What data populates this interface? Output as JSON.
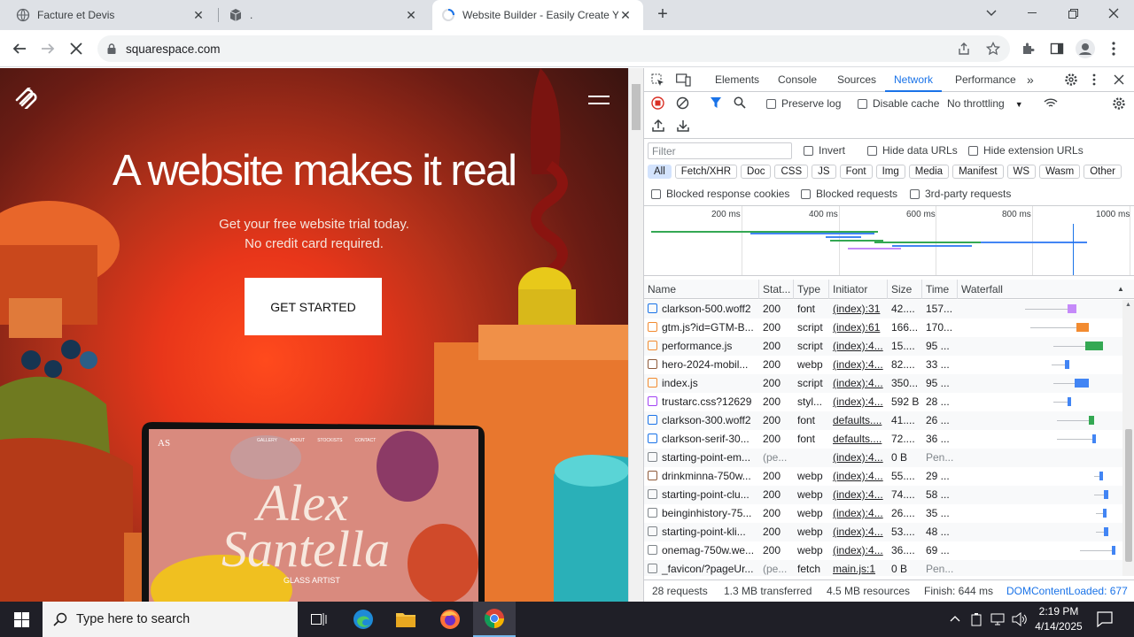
{
  "tabs": [
    {
      "title": "Facture et Devis",
      "favicon": "globe-icon"
    },
    {
      "title": ".",
      "favicon": "cube-icon"
    },
    {
      "title": "Website Builder - Easily Create Y",
      "favicon": "chrome-loading-icon",
      "active": true
    }
  ],
  "toolbar": {
    "url": "squarespace.com"
  },
  "page": {
    "headline": "A website makes it real",
    "subline1": "Get your free website trial today.",
    "subline2": "No credit card required.",
    "cta": "GET STARTED",
    "laptop_name1": "Alex",
    "laptop_name2": "Santella",
    "laptop_caption": "GLASS ARTIST",
    "laptop_nav": [
      "GALLERY",
      "ABOUT",
      "STOCKISTS",
      "CONTACT"
    ],
    "laptop_logo": "AS"
  },
  "devtools": {
    "tabs": [
      "Elements",
      "Console",
      "Sources",
      "Network",
      "Performance"
    ],
    "active_tab": "Network",
    "preserve_log": "Preserve log",
    "disable_cache": "Disable cache",
    "throttling": "No throttling",
    "filter_placeholder": "Filter",
    "invert": "Invert",
    "hide_data_urls": "Hide data URLs",
    "hide_extension_urls": "Hide extension URLs",
    "type_filters": [
      "All",
      "Fetch/XHR",
      "Doc",
      "CSS",
      "JS",
      "Font",
      "Img",
      "Media",
      "Manifest",
      "WS",
      "Wasm",
      "Other"
    ],
    "blocked_response_cookies": "Blocked response cookies",
    "blocked_requests": "Blocked requests",
    "third_party": "3rd-party requests",
    "timeline_ticks": [
      "200 ms",
      "400 ms",
      "600 ms",
      "800 ms",
      "1000 ms"
    ],
    "columns": [
      "Name",
      "Stat...",
      "Type",
      "Initiator",
      "Size",
      "Time",
      "Waterfall"
    ],
    "rows": [
      {
        "name": "clarkson-500.woff2",
        "status": "200",
        "type": "font",
        "initiator": "(index):31",
        "size": "42....",
        "time": "157...",
        "icon": "font"
      },
      {
        "name": "gtm.js?id=GTM-B...",
        "status": "200",
        "type": "script",
        "initiator": "(index):61",
        "size": "166...",
        "time": "170...",
        "icon": "script"
      },
      {
        "name": "performance.js",
        "status": "200",
        "type": "script",
        "initiator": "(index):4...",
        "size": "15....",
        "time": "95 ...",
        "icon": "script"
      },
      {
        "name": "hero-2024-mobil...",
        "status": "200",
        "type": "webp",
        "initiator": "(index):4...",
        "size": "82....",
        "time": "33 ...",
        "icon": "img"
      },
      {
        "name": "index.js",
        "status": "200",
        "type": "script",
        "initiator": "(index):4...",
        "size": "350...",
        "time": "95 ...",
        "icon": "script"
      },
      {
        "name": "trustarc.css?12629",
        "status": "200",
        "type": "styl...",
        "initiator": "(index):4...",
        "size": "592 B",
        "time": "28 ...",
        "icon": "css"
      },
      {
        "name": "clarkson-300.woff2",
        "status": "200",
        "type": "font",
        "initiator": "defaults....",
        "size": "41....",
        "time": "26 ...",
        "icon": "font"
      },
      {
        "name": "clarkson-serif-30...",
        "status": "200",
        "type": "font",
        "initiator": "defaults....",
        "size": "72....",
        "time": "36 ...",
        "icon": "font"
      },
      {
        "name": "starting-point-em...",
        "status": "(pe...",
        "type": "",
        "initiator": "(index):4...",
        "size": "0 B",
        "time": "Pen...",
        "icon": "doc"
      },
      {
        "name": "drinkminna-750w...",
        "status": "200",
        "type": "webp",
        "initiator": "(index):4...",
        "size": "55....",
        "time": "29 ...",
        "icon": "img"
      },
      {
        "name": "starting-point-clu...",
        "status": "200",
        "type": "webp",
        "initiator": "(index):4...",
        "size": "74....",
        "time": "58 ...",
        "icon": "doc"
      },
      {
        "name": "beinginhistory-75...",
        "status": "200",
        "type": "webp",
        "initiator": "(index):4...",
        "size": "26....",
        "time": "35 ...",
        "icon": "doc"
      },
      {
        "name": "starting-point-kli...",
        "status": "200",
        "type": "webp",
        "initiator": "(index):4...",
        "size": "53....",
        "time": "48 ...",
        "icon": "doc"
      },
      {
        "name": "onemag-750w.we...",
        "status": "200",
        "type": "webp",
        "initiator": "(index):4...",
        "size": "36....",
        "time": "69 ...",
        "icon": "doc"
      },
      {
        "name": "_favicon/?pageUr...",
        "status": "(pe...",
        "type": "fetch",
        "initiator": "main.js:1",
        "size": "0 B",
        "time": "Pen...",
        "icon": "doc"
      }
    ],
    "status_bar": {
      "requests": "28 requests",
      "transferred": "1.3 MB transferred",
      "resources": "4.5 MB resources",
      "finish": "Finish: 644 ms",
      "dcl": "DOMContentLoaded: 677"
    }
  },
  "taskbar": {
    "search_placeholder": "Type here to search",
    "time": "2:19 PM",
    "date": "4/14/2025"
  },
  "colors": {
    "accent": "#1a73e8",
    "record_red": "#d93025",
    "taskbar": "#1f1f27"
  }
}
